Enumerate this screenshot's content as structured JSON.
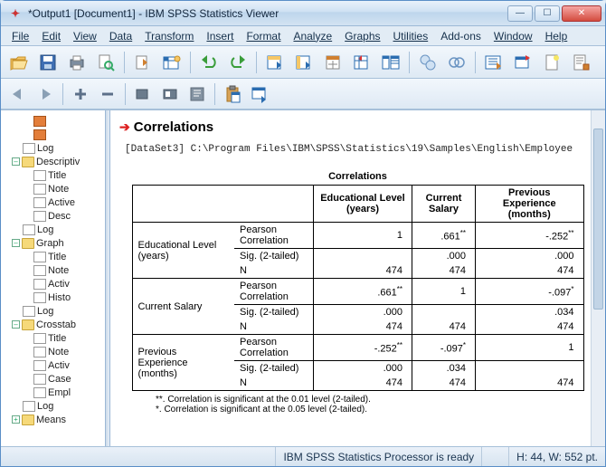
{
  "window": {
    "title": "*Output1 [Document1] - IBM SPSS Statistics Viewer"
  },
  "menu": {
    "file": "File",
    "edit": "Edit",
    "view": "View",
    "data": "Data",
    "transform": "Transform",
    "insert": "Insert",
    "format": "Format",
    "analyze": "Analyze",
    "graphs": "Graphs",
    "utilities": "Utilities",
    "addons": "Add-ons",
    "window": "Window",
    "help": "Help"
  },
  "outline": {
    "items": [
      {
        "label": "Log"
      },
      {
        "label": "Descriptiv"
      },
      {
        "label": "Title"
      },
      {
        "label": "Note"
      },
      {
        "label": "Active"
      },
      {
        "label": "Desc"
      },
      {
        "label": "Log"
      },
      {
        "label": "Graph"
      },
      {
        "label": "Title"
      },
      {
        "label": "Note"
      },
      {
        "label": "Activ"
      },
      {
        "label": "Histo"
      },
      {
        "label": "Log"
      },
      {
        "label": "Crosstab"
      },
      {
        "label": "Title"
      },
      {
        "label": "Note"
      },
      {
        "label": "Activ"
      },
      {
        "label": "Case"
      },
      {
        "label": "Empl"
      },
      {
        "label": "Log"
      },
      {
        "label": "Means"
      }
    ]
  },
  "content": {
    "section_title": "Correlations",
    "dataset_line": "[DataSet3] C:\\Program Files\\IBM\\SPSS\\Statistics\\19\\Samples\\English\\Employee",
    "table_title": "Correlations",
    "col_headers": {
      "stat": "",
      "c1": "Educational Level (years)",
      "c2": "Current Salary",
      "c3": "Previous Experience (months)"
    },
    "rows": [
      {
        "var": "Educational Level (years)",
        "stat": "Pearson Correlation",
        "v1": "1",
        "v2": ".661",
        "v2s": "**",
        "v3": "-.252",
        "v3s": "**"
      },
      {
        "stat": "Sig. (2-tailed)",
        "v1": "",
        "v2": ".000",
        "v3": ".000"
      },
      {
        "stat": "N",
        "v1": "474",
        "v2": "474",
        "v3": "474"
      },
      {
        "var": "Current Salary",
        "stat": "Pearson Correlation",
        "v1": ".661",
        "v1s": "**",
        "v2": "1",
        "v3": "-.097",
        "v3s": "*"
      },
      {
        "stat": "Sig. (2-tailed)",
        "v1": ".000",
        "v2": "",
        "v3": ".034"
      },
      {
        "stat": "N",
        "v1": "474",
        "v2": "474",
        "v3": "474"
      },
      {
        "var": "Previous Experience (months)",
        "stat": "Pearson Correlation",
        "v1": "-.252",
        "v1s": "**",
        "v2": "-.097",
        "v2s": "*",
        "v3": "1"
      },
      {
        "stat": "Sig. (2-tailed)",
        "v1": ".000",
        "v2": ".034",
        "v3": ""
      },
      {
        "stat": "N",
        "v1": "474",
        "v2": "474",
        "v3": "474"
      }
    ],
    "footnote1": "**. Correlation is significant at the 0.01 level (2-tailed).",
    "footnote2": "*. Correlation is significant at the 0.05 level (2-tailed)."
  },
  "status": {
    "processor": "IBM SPSS Statistics Processor is ready",
    "coords": "H: 44, W: 552 pt."
  },
  "chart_data": {
    "type": "table",
    "title": "Correlations",
    "variables": [
      "Educational Level (years)",
      "Current Salary",
      "Previous Experience (months)"
    ],
    "statistics": [
      "Pearson Correlation",
      "Sig. (2-tailed)",
      "N"
    ],
    "pearson_correlation": [
      [
        1,
        0.661,
        -0.252
      ],
      [
        0.661,
        1,
        -0.097
      ],
      [
        -0.252,
        -0.097,
        1
      ]
    ],
    "sig_2tailed": [
      [
        null,
        0.0,
        0.0
      ],
      [
        0.0,
        null,
        0.034
      ],
      [
        0.0,
        0.034,
        null
      ]
    ],
    "n": [
      [
        474,
        474,
        474
      ],
      [
        474,
        474,
        474
      ],
      [
        474,
        474,
        474
      ]
    ],
    "significance_markers": [
      [
        "",
        "**",
        "**"
      ],
      [
        "**",
        "",
        "*"
      ],
      [
        "**",
        "*",
        ""
      ]
    ],
    "footnotes": [
      "**. Correlation is significant at the 0.01 level (2-tailed).",
      "*. Correlation is significant at the 0.05 level (2-tailed)."
    ]
  }
}
